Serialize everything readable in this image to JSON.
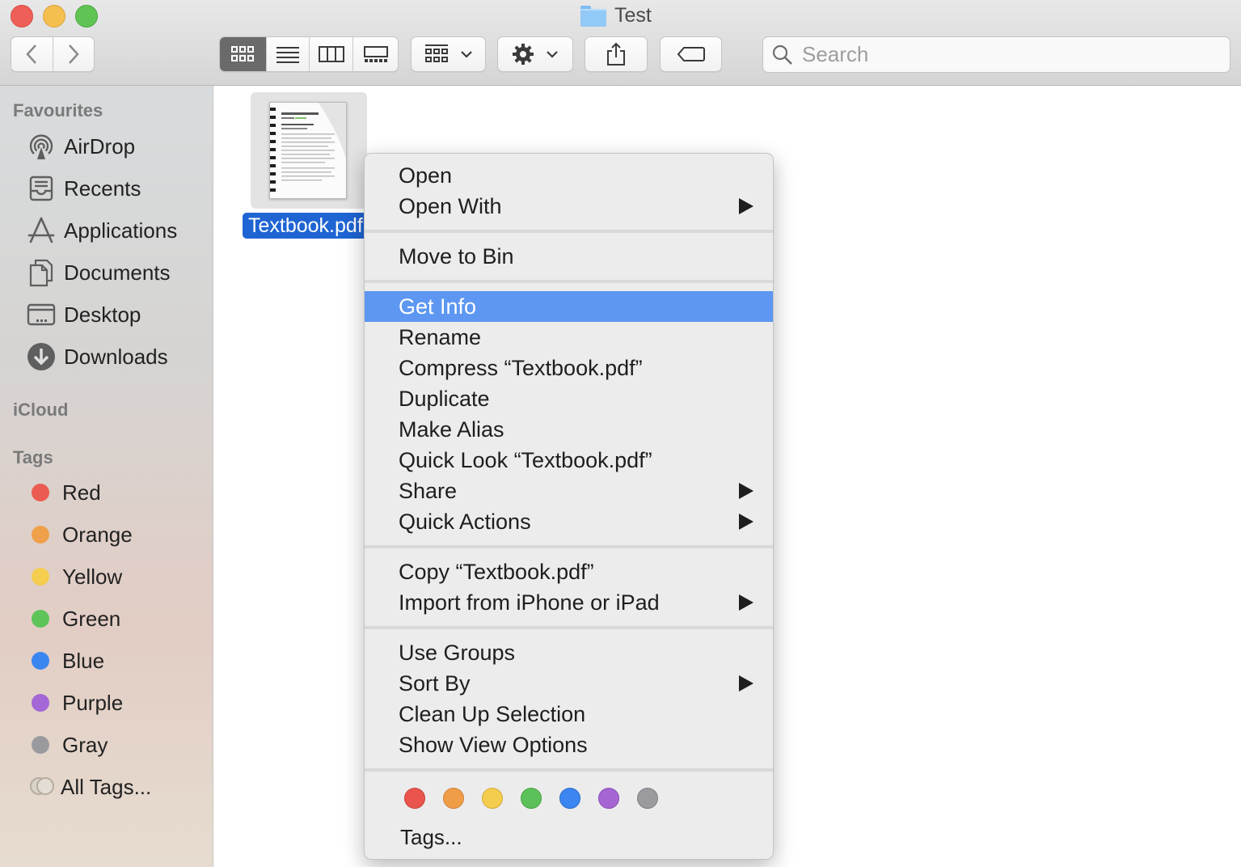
{
  "window": {
    "title": "Test"
  },
  "search": {
    "placeholder": "Search"
  },
  "sidebar": {
    "sections": {
      "favourites": "Favourites",
      "icloud": "iCloud",
      "tags": "Tags"
    },
    "favourites": [
      {
        "label": "AirDrop",
        "icon": "airdrop-icon"
      },
      {
        "label": "Recents",
        "icon": "recents-icon"
      },
      {
        "label": "Applications",
        "icon": "applications-icon"
      },
      {
        "label": "Documents",
        "icon": "documents-icon"
      },
      {
        "label": "Desktop",
        "icon": "desktop-icon"
      },
      {
        "label": "Downloads",
        "icon": "downloads-icon"
      }
    ],
    "tags": [
      {
        "label": "Red",
        "color": "#ec5b52"
      },
      {
        "label": "Orange",
        "color": "#f0a04b"
      },
      {
        "label": "Yellow",
        "color": "#f5cd4f"
      },
      {
        "label": "Green",
        "color": "#5ec45a"
      },
      {
        "label": "Blue",
        "color": "#3a86f1"
      },
      {
        "label": "Purple",
        "color": "#a467d6"
      },
      {
        "label": "Gray",
        "color": "#9a9a9e"
      },
      {
        "label": "All Tags...",
        "color": "#d8d2c8"
      }
    ]
  },
  "file": {
    "name": "Textbook.pdf"
  },
  "context_menu": {
    "items": [
      {
        "label": "Open"
      },
      {
        "label": "Open With",
        "submenu": true
      },
      {
        "label": "Move to Bin"
      },
      {
        "label": "Get Info",
        "highlighted": true
      },
      {
        "label": "Rename"
      },
      {
        "label": "Compress “Textbook.pdf”"
      },
      {
        "label": "Duplicate"
      },
      {
        "label": "Make Alias"
      },
      {
        "label": "Quick Look “Textbook.pdf”"
      },
      {
        "label": "Share",
        "submenu": true
      },
      {
        "label": "Quick Actions",
        "submenu": true
      },
      {
        "label": "Copy “Textbook.pdf”"
      },
      {
        "label": "Import from iPhone or iPad",
        "submenu": true
      },
      {
        "label": "Use Groups"
      },
      {
        "label": "Sort By",
        "submenu": true
      },
      {
        "label": "Clean Up Selection"
      },
      {
        "label": "Show View Options"
      }
    ],
    "tag_colors": [
      "#e9554d",
      "#ef9d47",
      "#f4cc4e",
      "#5dc15a",
      "#3b86f0",
      "#a566d4",
      "#9b9b9f"
    ],
    "tags_label": "Tags..."
  }
}
